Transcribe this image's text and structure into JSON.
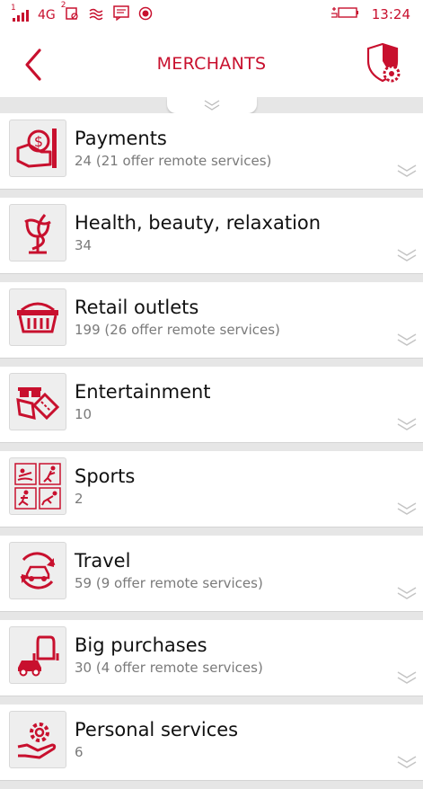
{
  "status_bar": {
    "network": "4G",
    "time": "13:24",
    "sim1": "1",
    "sim2": "2"
  },
  "header": {
    "title": "MERCHANTS",
    "back_icon": "chevron-left-icon",
    "action_icon": "shield-settings-icon"
  },
  "colors": {
    "accent": "#c8102e",
    "background": "#e6e6e6",
    "card": "#ffffff"
  },
  "categories": [
    {
      "name": "Payments",
      "detail": "24 (21 offer remote services)",
      "icon": "payments-icon"
    },
    {
      "name": "Health, beauty, relaxation",
      "detail": "34",
      "icon": "health-icon"
    },
    {
      "name": "Retail outlets",
      "detail": "199 (26 offer remote services)",
      "icon": "basket-icon"
    },
    {
      "name": "Entertainment",
      "detail": "10",
      "icon": "entertainment-icon"
    },
    {
      "name": "Sports",
      "detail": "2",
      "icon": "sports-icon"
    },
    {
      "name": "Travel",
      "detail": "59 (9 offer remote services)",
      "icon": "travel-icon"
    },
    {
      "name": "Big purchases",
      "detail": "30 (4 offer remote services)",
      "icon": "big-purchases-icon"
    },
    {
      "name": "Personal services",
      "detail": "6",
      "icon": "personal-services-icon"
    }
  ]
}
